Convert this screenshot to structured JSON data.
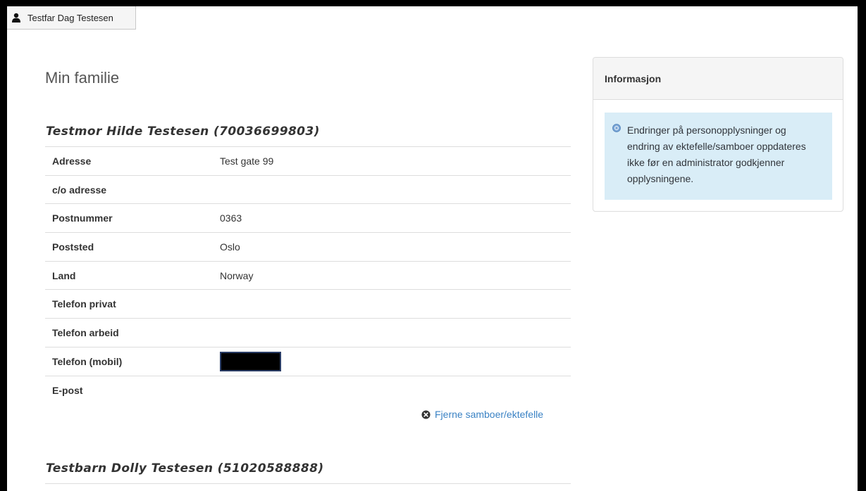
{
  "user": {
    "name": "Testfar Dag Testesen",
    "icon": "user-icon"
  },
  "page": {
    "title": "Min familie"
  },
  "persons": [
    {
      "heading": "Testmor Hilde Testesen (70036699803)",
      "fields": [
        {
          "label": "Adresse",
          "value": "Test gate 99"
        },
        {
          "label": "c/o adresse",
          "value": ""
        },
        {
          "label": "Postnummer",
          "value": "0363"
        },
        {
          "label": "Poststed",
          "value": "Oslo"
        },
        {
          "label": "Land",
          "value": "Norway"
        },
        {
          "label": "Telefon privat",
          "value": ""
        },
        {
          "label": "Telefon arbeid",
          "value": ""
        },
        {
          "label": "Telefon (mobil)",
          "value": ""
        },
        {
          "label": "E-post",
          "value": ""
        }
      ],
      "action": {
        "label": "Fjerne samboer/ektefelle",
        "icon": "remove-circle-icon"
      }
    },
    {
      "heading": "Testbarn Dolly Testesen (51020588888)"
    }
  ],
  "info_panel": {
    "title": "Informasjon",
    "icon": "info-icon",
    "message": "Endringer på personopplysninger og endring av ektefelle/samboer oppdateres ikke før en administrator godkjenner opplysningene."
  },
  "colors": {
    "link": "#3a82c4",
    "info_bg": "#d9edf7",
    "border": "#dddddd"
  }
}
